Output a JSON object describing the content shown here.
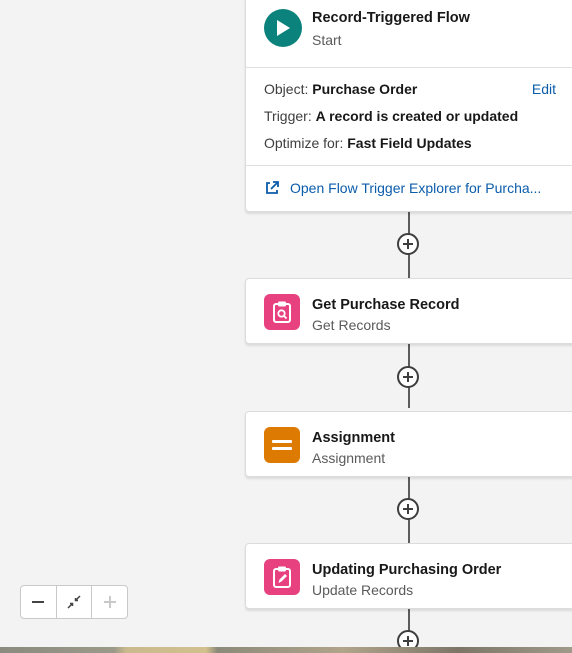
{
  "start_node": {
    "title": "Record-Triggered Flow",
    "subtitle": "Start",
    "object_label": "Object:",
    "object_value": "Purchase Order",
    "edit_label": "Edit",
    "trigger_label": "Trigger:",
    "trigger_value": "A record is created or updated",
    "optimize_label": "Optimize for:",
    "optimize_value": "Fast Field Updates",
    "explorer_link": "Open Flow Trigger Explorer for Purcha...",
    "icon": "play-icon",
    "color": "#0b827c"
  },
  "nodes": [
    {
      "title": "Get Purchase Record",
      "subtitle": "Get Records",
      "icon": "get-records-icon",
      "color": "#e8417f"
    },
    {
      "title": "Assignment",
      "subtitle": "Assignment",
      "icon": "assignment-icon",
      "color": "#dd7a01"
    },
    {
      "title": "Updating Purchasing Order",
      "subtitle": "Update Records",
      "icon": "update-records-icon",
      "color": "#e8417f"
    }
  ],
  "zoom_controls": {
    "zoom_out_icon": "minus-icon",
    "fit_icon": "fit-view-icon",
    "zoom_in_icon": "plus-icon"
  },
  "colors": {
    "link": "#0b5cab",
    "canvas": "#f3f3f3"
  }
}
